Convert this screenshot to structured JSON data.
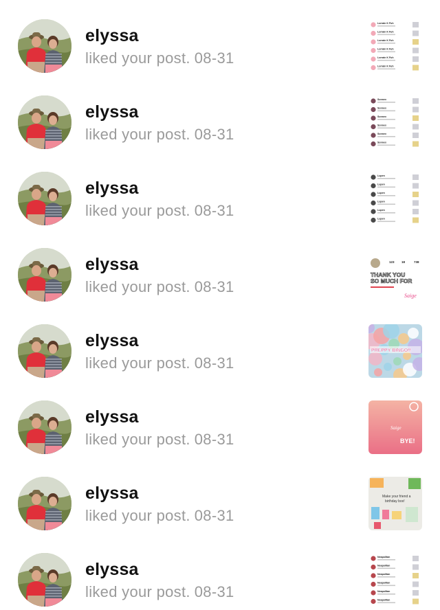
{
  "notifications": [
    {
      "user": "elyssa",
      "action": "liked your post.",
      "date": "08-31",
      "avatar_icon": "couple-photo-avatar",
      "thumb": {
        "kind": "list",
        "accent": "#f2a9b7",
        "texts": [
          "Lorrain K Fuh",
          "Lorrain K Fuh",
          "Lorrain K Fuh",
          "Lorrain K Fuh",
          "Lorrain K Fuh",
          "Lorrain K Fuh"
        ]
      }
    },
    {
      "user": "elyssa",
      "action": "liked your post.",
      "date": "08-31",
      "avatar_icon": "couple-photo-avatar",
      "thumb": {
        "kind": "list",
        "accent": "#7a4a5a",
        "texts": [
          "Sonnex",
          "Sonnex",
          "Sonnex",
          "Sonnex",
          "Sonnex",
          "Sonnex"
        ]
      }
    },
    {
      "user": "elyssa",
      "action": "liked your post.",
      "date": "08-31",
      "avatar_icon": "couple-photo-avatar",
      "thumb": {
        "kind": "list",
        "accent": "#4a4a4a",
        "texts": [
          "Lupen",
          "Lupen",
          "Lupen",
          "Lupen",
          "Lupen",
          "Lupen"
        ]
      }
    },
    {
      "user": "elyssa",
      "action": "liked your post.",
      "date": "08-31",
      "avatar_icon": "couple-photo-avatar",
      "thumb": {
        "kind": "profile",
        "texts": [
          "THANK YOU",
          "SO MUCH FOR",
          "Saige",
          "123",
          "18",
          "738"
        ]
      }
    },
    {
      "user": "elyssa",
      "action": "liked your post.",
      "date": "08-31",
      "avatar_icon": "couple-photo-avatar",
      "thumb": {
        "kind": "collage",
        "texts": [
          "PREPPY BINGO!!"
        ]
      }
    },
    {
      "user": "elyssa",
      "action": "liked your post.",
      "date": "08-31",
      "avatar_icon": "couple-photo-avatar",
      "thumb": {
        "kind": "pink",
        "texts": [
          "BYE!",
          "Saige"
        ]
      }
    },
    {
      "user": "elyssa",
      "action": "liked your post.",
      "date": "08-31",
      "avatar_icon": "couple-photo-avatar",
      "thumb": {
        "kind": "birthday",
        "texts": [
          "Make your friend a",
          "birthday box!"
        ]
      }
    },
    {
      "user": "elyssa",
      "action": "liked your post.",
      "date": "08-31",
      "avatar_icon": "couple-photo-avatar",
      "thumb": {
        "kind": "list",
        "accent": "#b7474d",
        "texts": [
          "Neapolitan",
          "Neapolitan",
          "Neapolitan",
          "Neapolitan",
          "Neapolitan",
          "Neapolitan"
        ]
      }
    }
  ]
}
